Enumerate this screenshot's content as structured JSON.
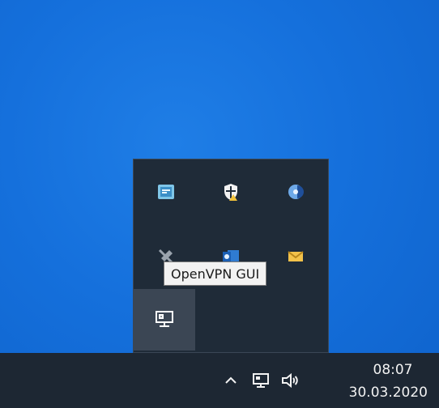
{
  "tooltip": {
    "text": "OpenVPN GUI"
  },
  "clock": {
    "time": "08:07",
    "date": "30.03.2020"
  },
  "tray_icons": [
    "network-app-icon",
    "security-shield-icon",
    "sync-app-icon",
    "muted-device-icon",
    "outlook-icon",
    "mail-icon",
    "openvpn-icon"
  ],
  "taskbar_icons": [
    "chevron-up-icon",
    "network-icon",
    "speaker-icon"
  ]
}
